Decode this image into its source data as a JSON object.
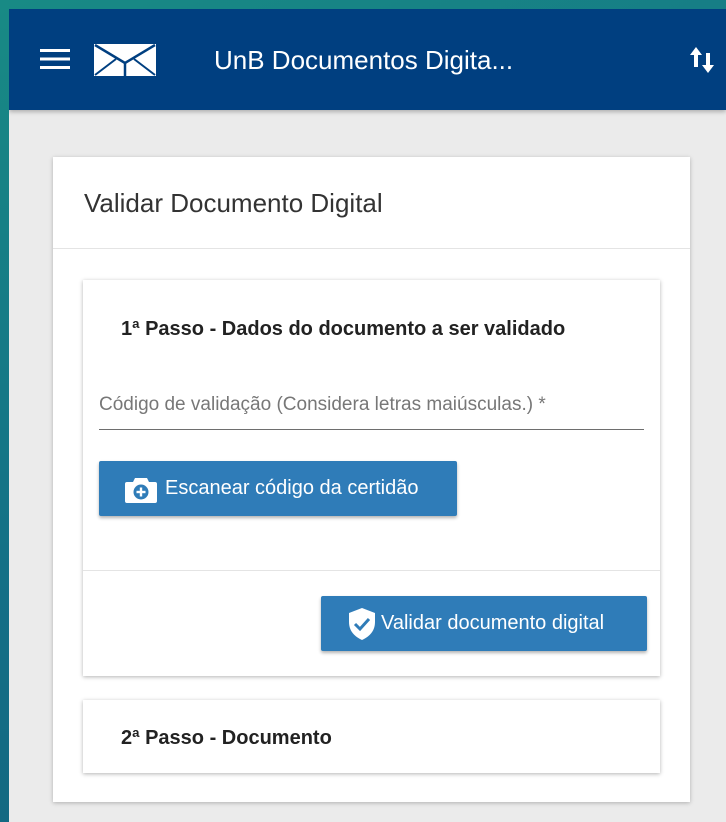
{
  "appbar": {
    "title": "UnB Documentos Digita...",
    "menu_icon": "hamburger-menu-icon",
    "logo_icon": "envelope-logo-icon",
    "sort_icon": "sort-arrows-icon",
    "background_color": "#003f80"
  },
  "card": {
    "title": "Validar Documento Digital"
  },
  "step1": {
    "title": "1ª Passo - Dados do documento a ser validado",
    "code_field": {
      "value": "",
      "placeholder": "Código de validação (Considera letras maiúsculas.) *"
    },
    "scan_button": {
      "label": "Escanear código da certidão",
      "icon": "camera-plus-icon"
    },
    "validate_button": {
      "label": "Validar documento digital",
      "icon": "shield-check-icon"
    },
    "button_color": "#2f7cb8"
  },
  "step2": {
    "title": "2ª Passo - Documento"
  }
}
